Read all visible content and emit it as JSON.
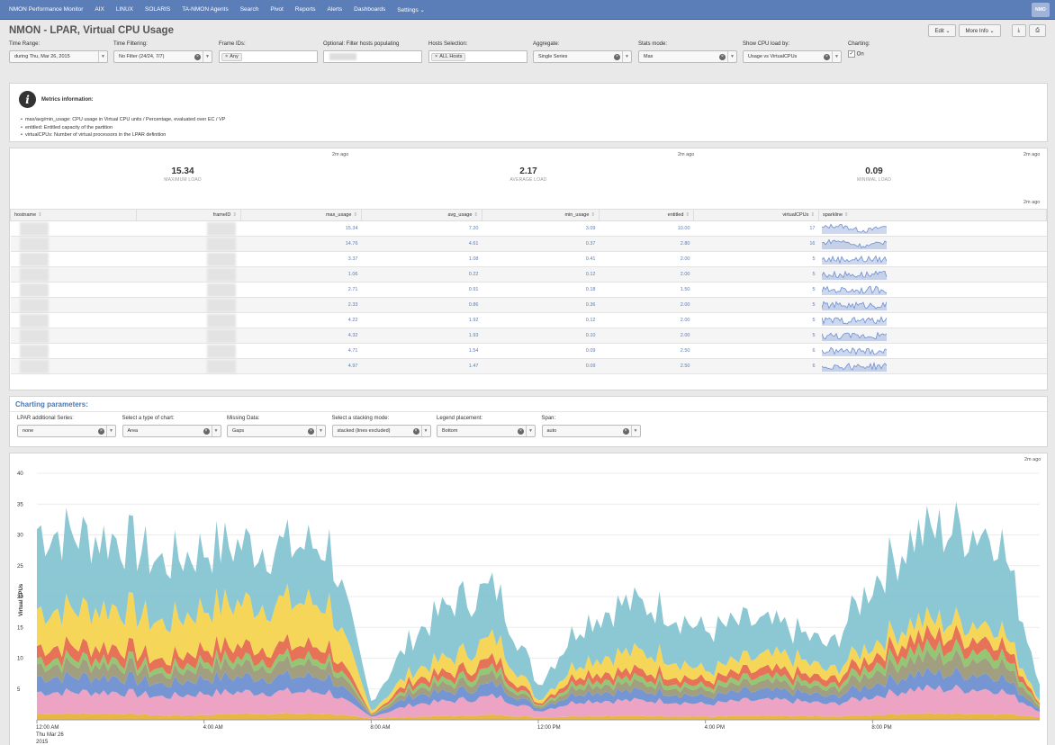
{
  "nav": {
    "items": [
      "NMON Performance Monitor",
      "AIX",
      "LINUX",
      "SOLARIS",
      "TA-NMON Agents",
      "Search",
      "Pivot",
      "Reports",
      "Alerts",
      "Dashboards",
      "Settings ⌄"
    ],
    "logo": "NMO"
  },
  "page": {
    "title": "NMON - LPAR, Virtual CPU Usage"
  },
  "actions": {
    "edit": "Edit ⌄",
    "more_info": "More Info ⌄",
    "export_icon": "download-icon",
    "print_icon": "print-icon"
  },
  "filters": {
    "time_range": {
      "label": "Time Range:",
      "value": "during Thu, Mar 26, 2015"
    },
    "time_filtering": {
      "label": "Time Filtering:",
      "value": "No Filter (24/24, 7/7)"
    },
    "frame_ids": {
      "label": "Frame IDs:",
      "token": "Any"
    },
    "filter_hosts": {
      "label": "Optional: Filter hosts populating"
    },
    "hosts_selection": {
      "label": "Hosts Selection:",
      "token": "ALL Hosts"
    },
    "aggregate": {
      "label": "Aggregate:",
      "value": "Single Series"
    },
    "stats_mode": {
      "label": "Stats mode:",
      "value": "Max"
    },
    "cpu_load_by": {
      "label": "Show CPU load by:",
      "value": "Usage vs VirtualCPUs"
    },
    "charting": {
      "label": "Charting:",
      "option": "On",
      "checked": true
    }
  },
  "metrics_info": {
    "title": "Metrics information:",
    "items": [
      "max/avg/min_usage: CPU usage in Virtual CPU units / Percentage, evaluated over EC / VP",
      "entitled: Entitled capacity of the partition",
      "virtualCPUs: Number of virtual processors in the LPAR definition"
    ]
  },
  "stats": {
    "ago": "2m ago",
    "max": {
      "value": "15.34",
      "label": "MAXIMUM LOAD"
    },
    "avg": {
      "value": "2.17",
      "label": "AVERAGE LOAD"
    },
    "min": {
      "value": "0.09",
      "label": "MINIMAL LOAD"
    }
  },
  "table": {
    "columns": [
      "hostname",
      "frameID",
      "max_usage",
      "avg_usage",
      "min_usage",
      "entitled",
      "virtualCPUs",
      "sparkline"
    ],
    "rows": [
      [
        "15.34",
        "7.20",
        "3.09",
        "10.00",
        "17"
      ],
      [
        "14.76",
        "4.61",
        "0.37",
        "2.80",
        "16"
      ],
      [
        "3.37",
        "1.08",
        "0.41",
        "2.00",
        "5"
      ],
      [
        "1.06",
        "0.22",
        "0.12",
        "2.00",
        "5"
      ],
      [
        "2.71",
        "0.91",
        "0.18",
        "1.50",
        "5"
      ],
      [
        "2.33",
        "0.86",
        "0.36",
        "2.00",
        "5"
      ],
      [
        "4.22",
        "1.92",
        "0.12",
        "2.00",
        "5"
      ],
      [
        "4.32",
        "1.93",
        "0.10",
        "2.00",
        "5"
      ],
      [
        "4.71",
        "1.54",
        "0.09",
        "2.50",
        "6"
      ],
      [
        "4.97",
        "1.47",
        "0.09",
        "2.50",
        "6"
      ]
    ]
  },
  "charting_params": {
    "title": "Charting parameters:",
    "fields": [
      {
        "label": "LPAR additional Series:",
        "value": "none"
      },
      {
        "label": "Select a type of chart:",
        "value": "Area"
      },
      {
        "label": "Missing Data:",
        "value": "Gaps"
      },
      {
        "label": "Select a stacking mode:",
        "value": "stacked (lines excluded)"
      },
      {
        "label": "Legend placement:",
        "value": "Bottom"
      },
      {
        "label": "Span:",
        "value": "auto"
      }
    ]
  },
  "chart_data": {
    "type": "area",
    "stacked": true,
    "ylabel": "Virtual CPUs",
    "ylim": [
      0,
      40
    ],
    "yticks": [
      "40",
      "35",
      "30",
      "25",
      "20",
      "15",
      "10",
      "5"
    ],
    "xticks": [
      "12:00 AM",
      "4:00 AM",
      "8:00 AM",
      "12:00 PM",
      "4:00 PM",
      "8:00 PM"
    ],
    "xdate": [
      "Thu Mar 26",
      "2015"
    ],
    "ago": "2m ago",
    "colors": [
      "#e5b33a",
      "#ec9ec0",
      "#6f8fd1",
      "#9c9a78",
      "#8fc36b",
      "#e56b4f",
      "#f6d44f",
      "#86c4d2"
    ],
    "x_hours": [
      0,
      1,
      2,
      3,
      4,
      5,
      6,
      7,
      8,
      9,
      10,
      11,
      12,
      13,
      14,
      15,
      16,
      17,
      18,
      19,
      20,
      21,
      22,
      23,
      24
    ],
    "series": [
      {
        "values": [
          1.0,
          1.0,
          1.0,
          0.7,
          0.8,
          1.0,
          1.0,
          1.0,
          0.2,
          0.5,
          0.6,
          0.8,
          0.4,
          0.6,
          0.6,
          0.6,
          0.5,
          0.6,
          0.6,
          0.5,
          0.8,
          1.0,
          1.0,
          1.0,
          0.5
        ]
      },
      {
        "values": [
          3.5,
          3.5,
          3.5,
          3.0,
          3.5,
          3.5,
          3.5,
          3.5,
          0.3,
          2.0,
          2.5,
          3.0,
          1.0,
          2.5,
          2.5,
          2.5,
          2.0,
          2.5,
          2.5,
          2.0,
          3.0,
          4.0,
          4.0,
          4.0,
          1.0
        ]
      },
      {
        "values": [
          2.5,
          2.5,
          2.5,
          2.0,
          2.5,
          2.5,
          2.5,
          2.5,
          0.2,
          1.5,
          1.5,
          2.0,
          0.5,
          1.5,
          1.5,
          1.5,
          1.2,
          1.5,
          1.5,
          1.2,
          2.0,
          2.5,
          2.5,
          2.5,
          0.5
        ]
      },
      {
        "values": [
          2.0,
          2.0,
          2.0,
          1.5,
          2.0,
          2.0,
          2.0,
          2.0,
          0.1,
          1.0,
          1.2,
          1.5,
          0.3,
          1.2,
          1.2,
          1.2,
          1.0,
          1.2,
          1.2,
          1.0,
          2.0,
          2.5,
          2.5,
          2.5,
          0.5
        ]
      },
      {
        "values": [
          1.0,
          1.0,
          1.0,
          0.8,
          1.0,
          1.0,
          1.0,
          1.0,
          0.1,
          0.6,
          0.8,
          1.0,
          0.2,
          0.8,
          0.8,
          0.8,
          0.6,
          0.8,
          0.8,
          0.6,
          1.2,
          1.5,
          1.5,
          1.5,
          0.3
        ]
      },
      {
        "values": [
          2.0,
          2.0,
          2.0,
          1.5,
          2.0,
          2.0,
          2.0,
          2.0,
          0.1,
          1.0,
          1.2,
          1.5,
          0.3,
          1.2,
          1.2,
          1.2,
          1.0,
          1.2,
          1.2,
          1.0,
          1.5,
          2.0,
          2.0,
          2.0,
          0.3
        ]
      },
      {
        "values": [
          6.0,
          6.0,
          6.5,
          6.0,
          6.5,
          7.0,
          7.0,
          7.0,
          0.5,
          1.5,
          2.5,
          3.5,
          0.5,
          2.0,
          3.0,
          3.0,
          1.5,
          2.0,
          2.5,
          1.5,
          2.0,
          2.5,
          2.5,
          2.5,
          0.5
        ]
      },
      {
        "values": [
          13.0,
          12.0,
          11.0,
          10.0,
          9.5,
          9.5,
          9.0,
          9.5,
          1.5,
          5.5,
          9.0,
          8.0,
          2.5,
          6.0,
          8.0,
          7.5,
          6.5,
          6.0,
          4.5,
          4.0,
          10.0,
          14.0,
          15.0,
          15.0,
          3.0
        ]
      }
    ]
  }
}
